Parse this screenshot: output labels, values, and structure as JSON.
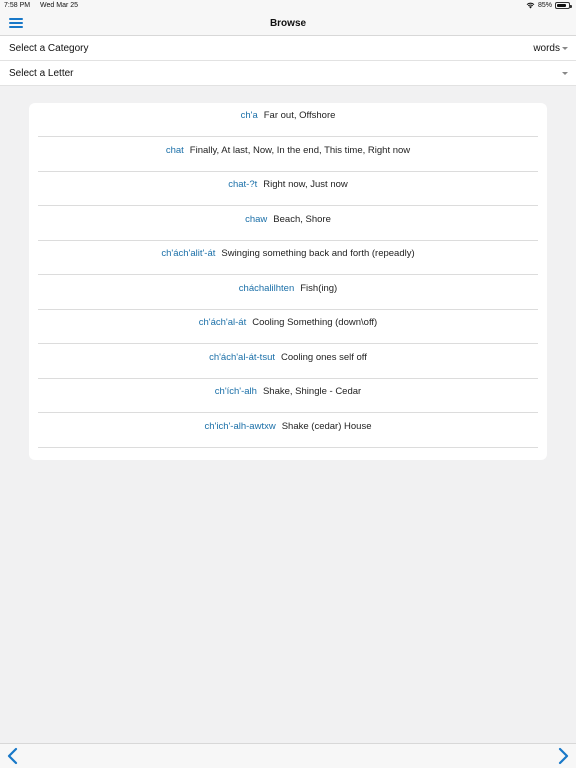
{
  "status": {
    "time": "7:58 PM",
    "date": "Wed Mar 25",
    "battery": "85%",
    "battery_level": 0.85
  },
  "nav": {
    "title": "Browse",
    "menu_icon": "hamburger-menu-icon"
  },
  "category": {
    "label": "Select a Category",
    "value": "words"
  },
  "letter": {
    "label": "Select a Letter",
    "value": ""
  },
  "entries": [
    {
      "word": "ch'a",
      "definition": "Far out, Offshore"
    },
    {
      "word": "chat",
      "definition": "Finally, At last, Now, In the end, This time, Right now"
    },
    {
      "word": "chat-?t",
      "definition": "Right now, Just now"
    },
    {
      "word": "chaw",
      "definition": "Beach, Shore"
    },
    {
      "word": "ch'ách'alit'-át",
      "definition": "Swinging something back and forth (repeadly)"
    },
    {
      "word": "cháchalilhten",
      "definition": "Fish(ing)"
    },
    {
      "word": "ch'ách'al-át",
      "definition": "Cooling Something (down\\off)"
    },
    {
      "word": "ch'ách'al-át-tsut",
      "definition": "Cooling ones self off"
    },
    {
      "word": "ch'ích'-alh",
      "definition": "Shake, Shingle - Cedar"
    },
    {
      "word": "ch'ich'-alh-awtxw",
      "definition": "Shake (cedar) House"
    }
  ],
  "colors": {
    "accent": "#1878c8",
    "word": "#1a6fa8",
    "background": "#f1f1f2"
  },
  "toolbar": {
    "back_icon": "chevron-left-icon",
    "forward_icon": "chevron-right-icon"
  }
}
